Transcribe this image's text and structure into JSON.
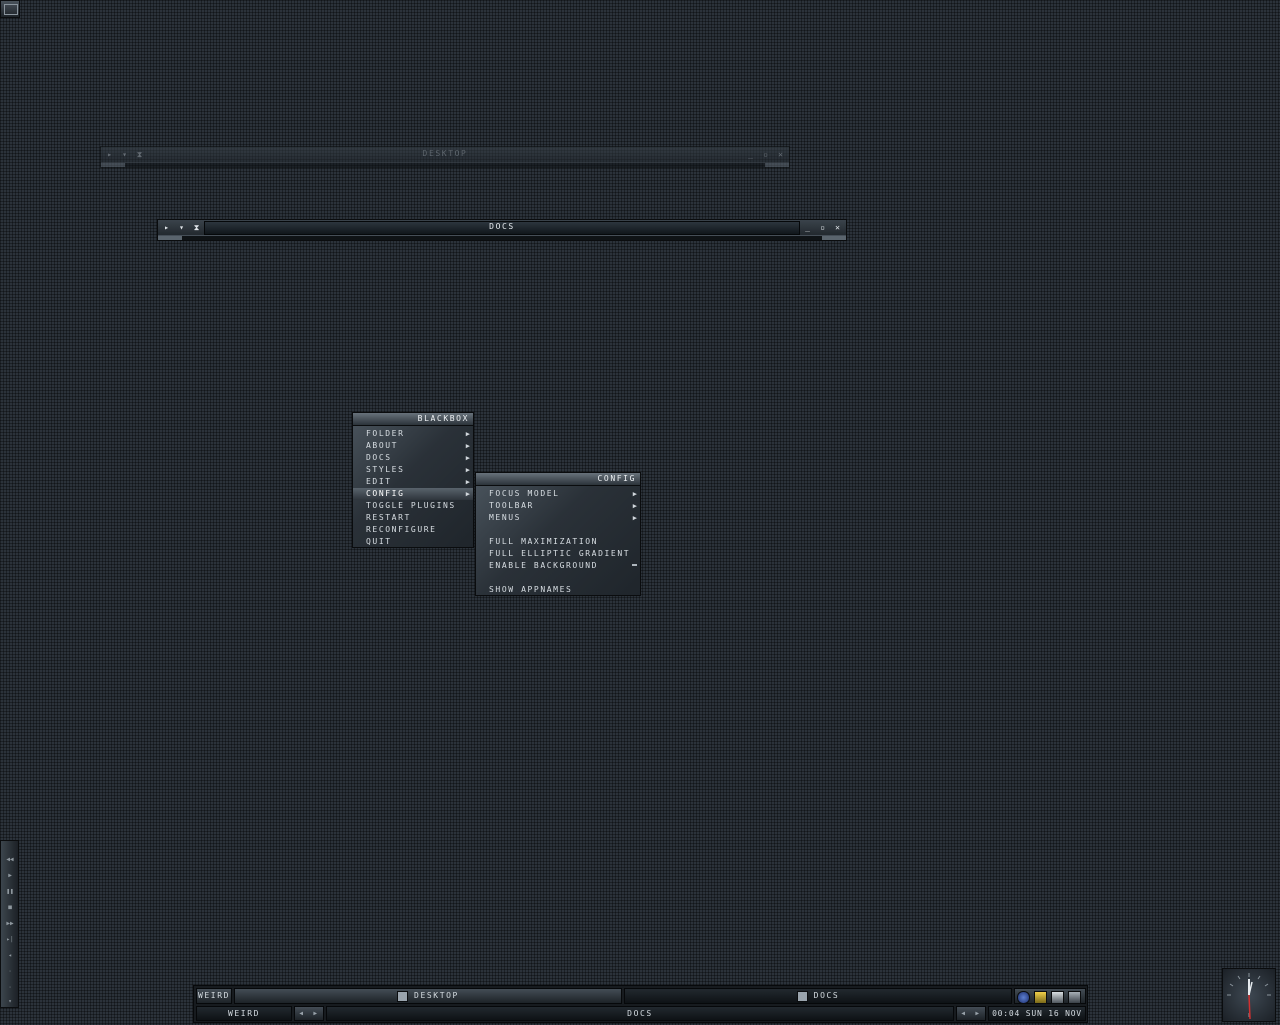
{
  "windows": {
    "desktop": {
      "title": "DESKTOP"
    },
    "docs": {
      "title": "DOCS"
    }
  },
  "window_buttons": {
    "left": [
      "▸",
      "▾",
      "⧗"
    ],
    "min": "_",
    "max": "▫",
    "close": "✕"
  },
  "menus": {
    "blackbox": {
      "title": "BLACKBOX",
      "items": [
        {
          "label": "FOLDER",
          "submenu": true
        },
        {
          "label": "ABOUT",
          "submenu": true
        },
        {
          "label": "DOCS",
          "submenu": true
        },
        {
          "label": "STYLES",
          "submenu": true
        },
        {
          "label": "EDIT",
          "submenu": true
        },
        {
          "label": "CONFIG",
          "submenu": true,
          "selected": true
        },
        {
          "label": "TOGGLE PLUGINS"
        },
        {
          "label": "RESTART"
        },
        {
          "label": "RECONFIGURE"
        },
        {
          "label": "QUIT"
        }
      ]
    },
    "config": {
      "title": "CONFIG",
      "items": [
        {
          "label": "FOCUS MODEL",
          "submenu": true
        },
        {
          "label": "TOOLBAR",
          "submenu": true
        },
        {
          "label": "MENUS",
          "submenu": true
        },
        {
          "label": "FULL MAXIMIZATION"
        },
        {
          "label": "FULL ELLIPTIC GRADIENT"
        },
        {
          "label": "ENABLE BACKGROUND",
          "checked": true
        },
        {
          "label": "SHOW APPNAMES"
        }
      ]
    }
  },
  "toolbar": {
    "workspace_top": "WEIRD",
    "task_desktop": "DESKTOP",
    "task_docs": "DOCS",
    "workspace_bottom": "WEIRD",
    "window_label": "DOCS",
    "clock": "00:04 SUN 16 NOV"
  },
  "icons": {
    "tray": [
      "network-icon",
      "notepad-icon",
      "settings-icon",
      "display-icon"
    ],
    "slit": [
      "rewind-icon",
      "play-icon",
      "pause-icon",
      "stop-icon",
      "forward-icon",
      "next-icon",
      "volume-icon",
      "dot-icon",
      "dot-icon",
      "down-icon"
    ]
  },
  "colors": {
    "background": "#2b323a",
    "selection": "#59636c",
    "clock_hand": "#d23030"
  }
}
